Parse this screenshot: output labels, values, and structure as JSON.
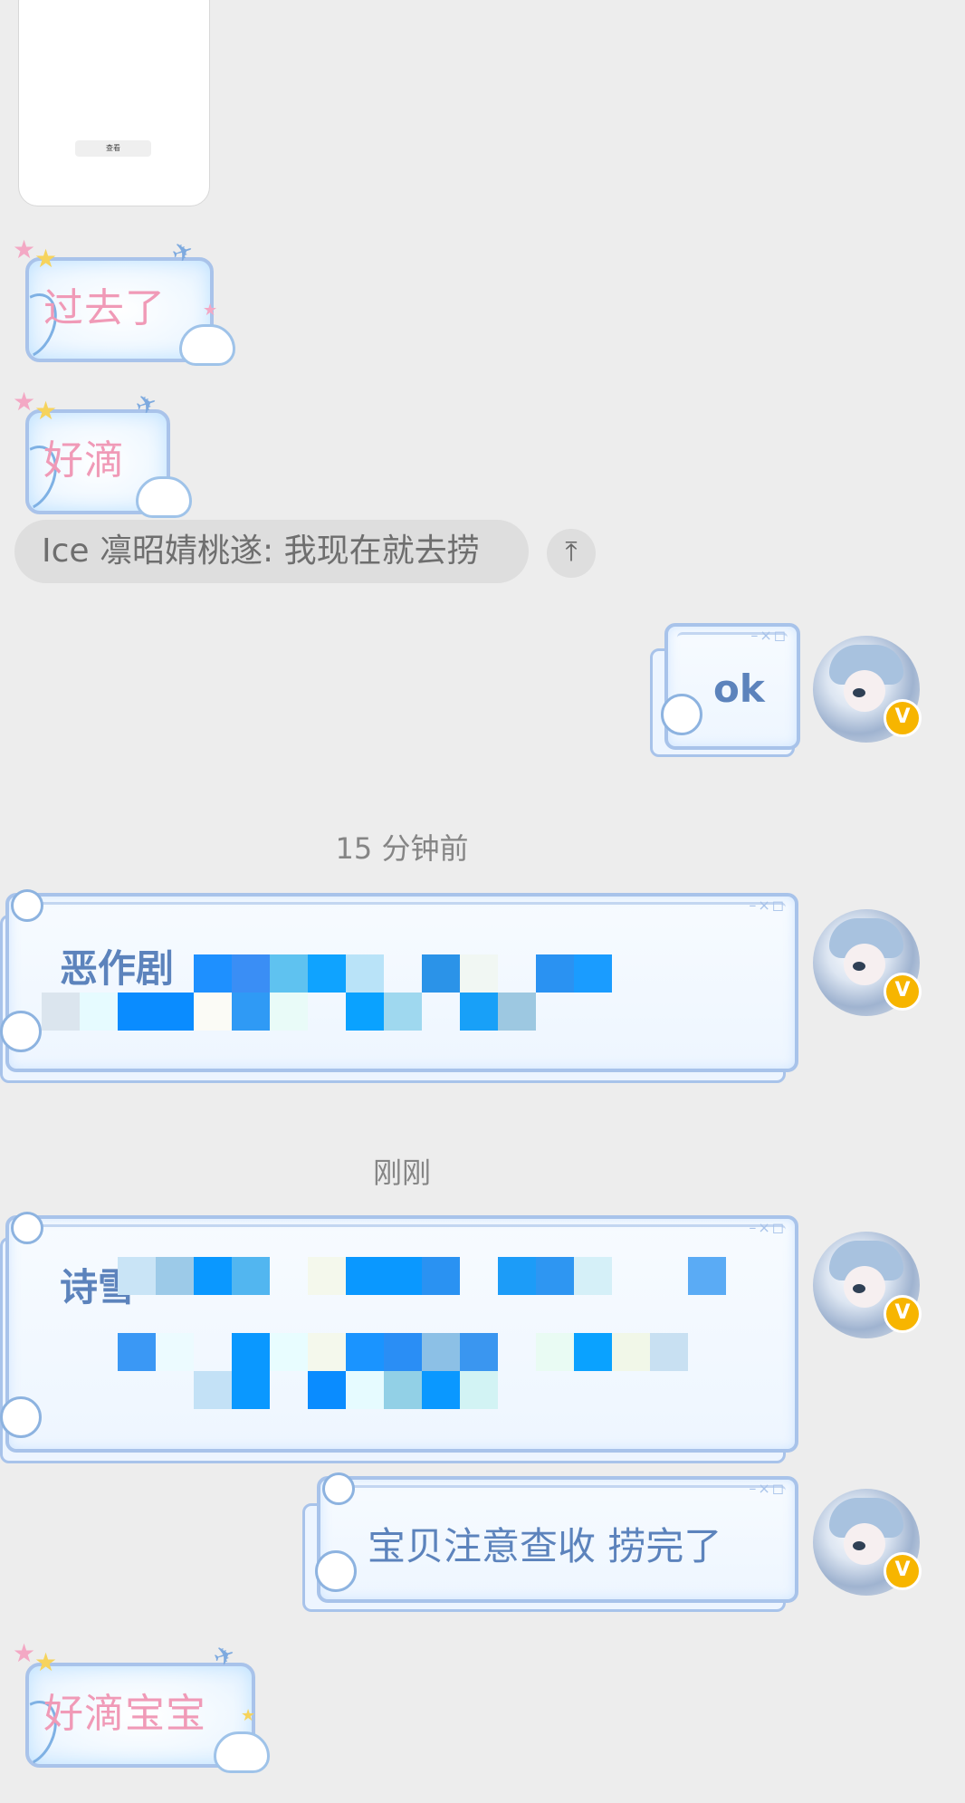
{
  "image_card": {
    "caption": "查看"
  },
  "messages": [
    {
      "id": "m1",
      "side": "left",
      "style": "pink-sticker",
      "text": "过去了"
    },
    {
      "id": "m2",
      "side": "left",
      "style": "pink-sticker",
      "text": "好滴"
    },
    {
      "id": "quote",
      "text": "Ice 凛昭婧桃遂: 我现在就去捞",
      "action_icon": "scroll-to-top-icon"
    },
    {
      "id": "m3",
      "side": "right",
      "style": "blue-frame",
      "text": "ok",
      "badge": "V"
    },
    {
      "id": "m4",
      "side": "right",
      "style": "blue-frame",
      "text": "恶作剧",
      "badge": "V"
    },
    {
      "id": "m5",
      "side": "right",
      "style": "blue-frame",
      "text": "诗雪",
      "badge": "V"
    },
    {
      "id": "m6",
      "side": "right",
      "style": "blue-frame",
      "text": "宝贝注意查收 捞完了",
      "badge": "V"
    },
    {
      "id": "m7",
      "side": "left",
      "style": "pink-sticker",
      "text": "好滴宝宝"
    }
  ],
  "timestamps": {
    "t1": "15 分钟前",
    "t2": "刚刚"
  },
  "frame_controls": "–×◻",
  "colors": {
    "background": "#ededed",
    "pink_text": "#f09ab7",
    "blue_text": "#5c83bc",
    "frame_border": "#a8c3ea",
    "badge": "#f7b500",
    "timestamp": "#858585"
  }
}
